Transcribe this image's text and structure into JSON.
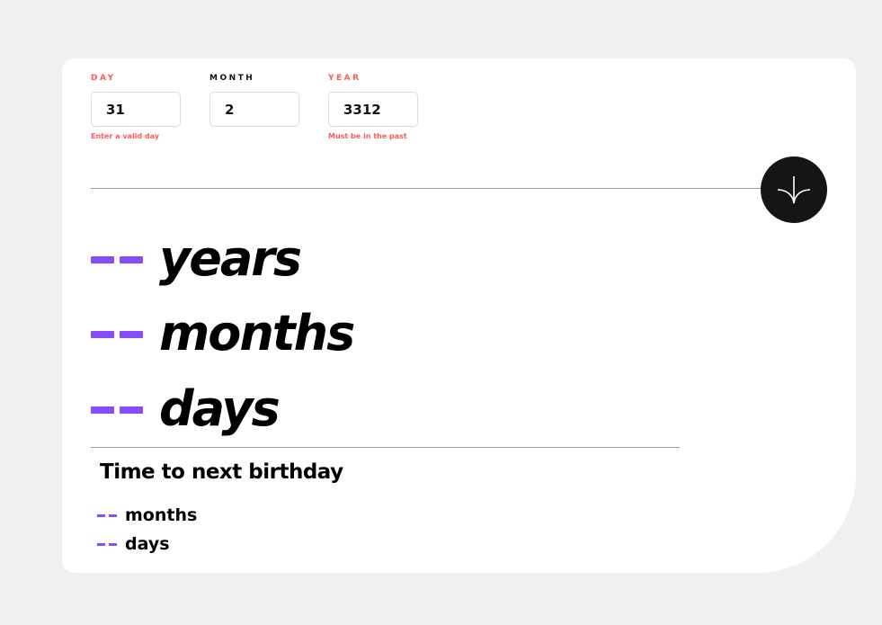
{
  "form": {
    "day": {
      "label": "DAY",
      "value": "31",
      "error": "Enter a valid day"
    },
    "month": {
      "label": "MONTH",
      "value": "2",
      "error": ""
    },
    "year": {
      "label": "YEAR",
      "value": "3312",
      "error": "Must be in the past"
    },
    "submit_icon": "arrow-down-icon"
  },
  "result": {
    "years": {
      "value": "--",
      "unit": "years"
    },
    "months": {
      "value": "--",
      "unit": "months"
    },
    "days": {
      "value": "--",
      "unit": "days"
    }
  },
  "next_birthday": {
    "title": "Time to next birthday",
    "months": {
      "value": "--",
      "unit": "months"
    },
    "days": {
      "value": "--",
      "unit": "days"
    }
  },
  "colors": {
    "accent": "#854dff",
    "error": "#ff5959",
    "button": "#151515",
    "background": "#f0f0f0",
    "card": "#ffffff"
  }
}
